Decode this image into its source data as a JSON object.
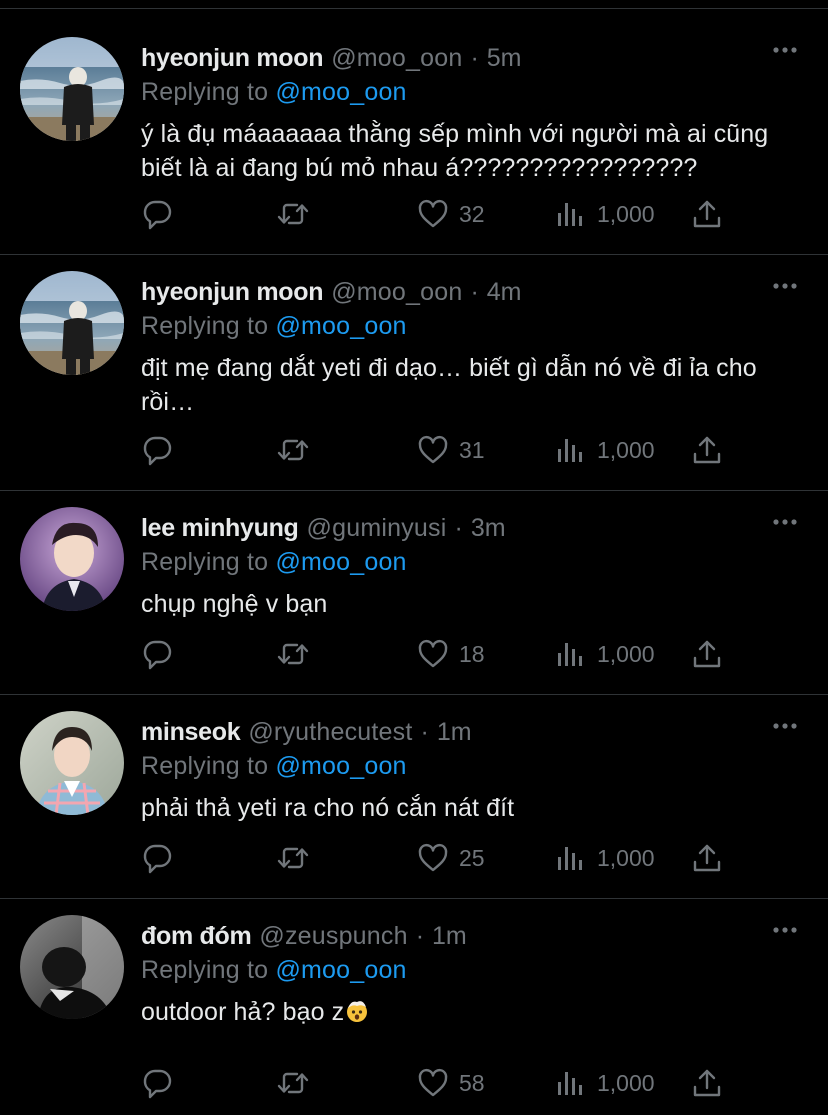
{
  "replies": [
    {
      "name": "hyeonjun moon",
      "handle": "@moo_oon",
      "time": "5m",
      "replying_prefix": "Replying to",
      "replying_to": "@moo_oon",
      "text": "ý là đụ máaaaaaa thằng sếp mình với người mà ai cũng biết là ai đang bú mỏ nhau á?????????????????",
      "likes": "32",
      "views": "1,000",
      "avatar": "beach-figure"
    },
    {
      "name": "hyeonjun moon",
      "handle": "@moo_oon",
      "time": "4m",
      "replying_prefix": "Replying to",
      "replying_to": "@moo_oon",
      "text": "địt mẹ đang dắt yeti đi dạo… biết gì dẫn nó về đi ỉa cho rồi…",
      "likes": "31",
      "views": "1,000",
      "avatar": "beach-figure"
    },
    {
      "name": "lee minhyung",
      "handle": "@guminyusi",
      "time": "3m",
      "replying_prefix": "Replying to",
      "replying_to": "@moo_oon",
      "text": "chụp nghệ v bạn",
      "likes": "18",
      "views": "1,000",
      "avatar": "purple-portrait"
    },
    {
      "name": "minseok",
      "handle": "@ryuthecutest",
      "time": "1m",
      "replying_prefix": "Replying to",
      "replying_to": "@moo_oon",
      "text": "phải thả yeti ra cho nó cắn nát đít",
      "likes": "25",
      "views": "1,000",
      "avatar": "plaid-portrait"
    },
    {
      "name": "đom đóm",
      "handle": "@zeuspunch",
      "time": "1m",
      "replying_prefix": "Replying to",
      "replying_to": "@moo_oon",
      "text": "outdoor hả? bạo z",
      "emoji": "exploding-head-emoji",
      "likes": "58",
      "views": "1,000",
      "avatar": "monochrome-portrait"
    }
  ],
  "colors": {
    "background": "#000000",
    "text": "#e7e9ea",
    "secondary": "#71767b",
    "accent": "#1d9bf0",
    "divider": "#2f3336"
  },
  "separator": "·"
}
